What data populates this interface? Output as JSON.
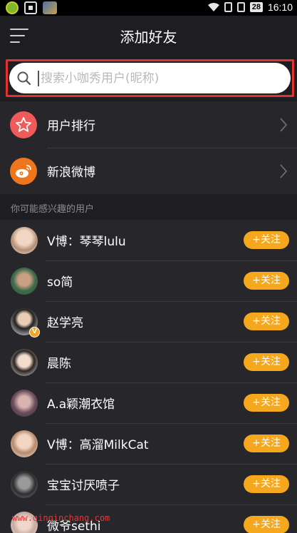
{
  "status_bar": {
    "battery": "28",
    "time": "16:10"
  },
  "header": {
    "title": "添加好友"
  },
  "search": {
    "placeholder": "搜索小咖秀用户(昵称)"
  },
  "menu": [
    {
      "label": "用户排行",
      "icon": "star-icon",
      "color": "#f15a5a"
    },
    {
      "label": "新浪微博",
      "icon": "weibo-icon",
      "color": "#f0761d"
    }
  ],
  "section": {
    "title": "你可能感兴趣的用户"
  },
  "follow_label": "+关注",
  "users": [
    {
      "name": "V博：琴琴lulu",
      "avatar_color": "#d7b8a0",
      "verified": false
    },
    {
      "name": "so简",
      "avatar_color": "#2f5a3a",
      "verified": false
    },
    {
      "name": "赵学亮",
      "avatar_color": "#3b3b3b",
      "verified": true
    },
    {
      "name": "晨陈",
      "avatar_color": "#e8e0dc",
      "verified": false
    },
    {
      "name": "A.a颖潮衣馆",
      "avatar_color": "#6b4d5d",
      "verified": false
    },
    {
      "name": "V博：高溜MilkCat",
      "avatar_color": "#e6c9b5",
      "verified": false
    },
    {
      "name": "宝宝讨厌喷子",
      "avatar_color": "#2e2e2e",
      "verified": false
    },
    {
      "name": "微爷sethi",
      "avatar_color": "#c7a9a0",
      "verified": false
    }
  ],
  "watermark": "www.qinqinchang.com",
  "colors": {
    "accent": "#f5a81d",
    "highlight_border": "#e3312f",
    "background": "#1e1e22"
  }
}
